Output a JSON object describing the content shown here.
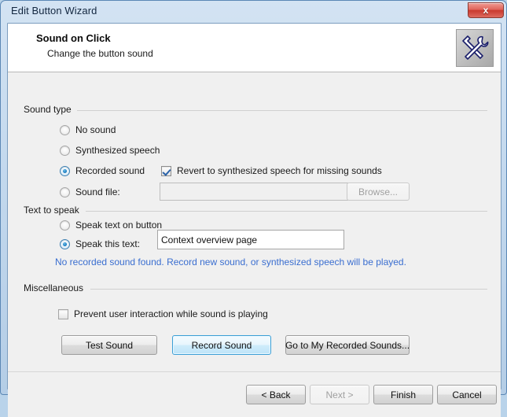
{
  "window": {
    "title": "Edit Button Wizard",
    "close_label": "x",
    "close_icon": "close-icon"
  },
  "header": {
    "title": "Sound on Click",
    "subtitle": "Change the button sound",
    "icon": "tools-wrench-screwdriver-icon"
  },
  "sound_type": {
    "group_label": "Sound type",
    "options": [
      {
        "label": "No sound",
        "selected": false
      },
      {
        "label": "Synthesized speech",
        "selected": false
      },
      {
        "label": "Recorded sound",
        "selected": true
      },
      {
        "label": "Sound file:",
        "selected": false
      }
    ],
    "revert_checkbox": {
      "label": "Revert to synthesized speech for missing sounds",
      "checked": true
    },
    "sound_file_input": {
      "value": "",
      "placeholder": "",
      "disabled": true
    },
    "browse_button": {
      "label": "Browse...",
      "disabled": true
    }
  },
  "text_to_speak": {
    "group_label": "Text to speak",
    "options": [
      {
        "label": "Speak text on button",
        "selected": false
      },
      {
        "label": "Speak this text:",
        "selected": true
      }
    ],
    "text_input": {
      "value": "Context overview page",
      "placeholder": ""
    },
    "info_message": "No recorded sound found. Record new sound, or synthesized speech will be played."
  },
  "miscellaneous": {
    "group_label": "Miscellaneous",
    "prevent_checkbox": {
      "label": "Prevent user interaction while sound is playing",
      "checked": false
    }
  },
  "action_buttons": {
    "test_sound": "Test Sound",
    "record_sound": "Record Sound",
    "go_to_recorded": "Go to My Recorded Sounds..."
  },
  "footer_buttons": {
    "back": "< Back",
    "next": "Next >",
    "finish": "Finish",
    "cancel": "Cancel"
  },
  "colors": {
    "accent_blue": "#3c9fd6",
    "info_blue": "#3a6ed0",
    "close_red": "#c9392e"
  }
}
